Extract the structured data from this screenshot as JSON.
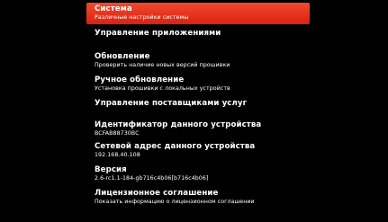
{
  "menu": {
    "items": [
      {
        "title": "Система",
        "subtitle": "Различные настройки системы",
        "selected": true
      },
      {
        "title": "Управление приложениями",
        "subtitle": ""
      },
      {
        "title": "Обновление",
        "subtitle": "Проверить наличие новых версий прошивки"
      },
      {
        "title": "Ручное обновление",
        "subtitle": "Установка прошивки с локальных устройств"
      },
      {
        "title": "Управление поставщиками услуг",
        "subtitle": ""
      },
      {
        "title": "Идентификатор данного устройства",
        "subtitle": "BCFAB88730BC"
      },
      {
        "title": "Сетевой адрес данного устройства",
        "subtitle": "192.168.40.108"
      },
      {
        "title": "Версия",
        "subtitle": "2.6-rc1.1-184-gb716c4b06[b716c4b06]"
      },
      {
        "title": "Лицензионное соглашение",
        "subtitle": "Показать информацию о лицензионном соглашении"
      }
    ]
  },
  "colors": {
    "background": "#000000",
    "selected_item": "#e8361c",
    "text": "#ffffff"
  }
}
